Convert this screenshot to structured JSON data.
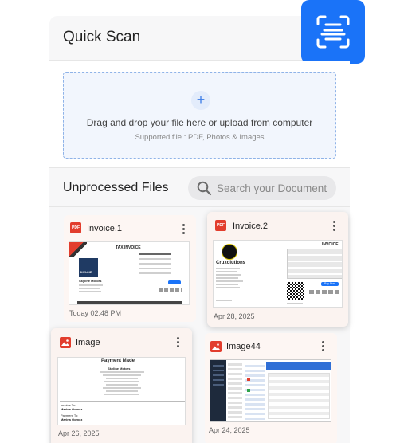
{
  "header": {
    "title": "Quick Scan"
  },
  "scan_button": {
    "icon": "scan-document-icon",
    "color": "#1a73f8"
  },
  "upload": {
    "icon": "plus-icon",
    "instruction": "Drag and drop your file here or upload from computer",
    "supported": "Supported file : PDF, Photos & Images"
  },
  "files": {
    "title": "Unprocessed Files",
    "search_placeholder": "Search your Document"
  },
  "cards": [
    {
      "type": "PDF",
      "name": "Invoice.1",
      "date": "Today 02:48 PM",
      "thumb": {
        "doc_title": "TAX INVOICE",
        "brand": "SKYLINE",
        "company": "Skyline Motors"
      }
    },
    {
      "type": "PDF",
      "name": "Invoice.2",
      "date": "Apr 28, 2025",
      "thumb": {
        "doc_title": "INVOICE",
        "company": "Cruxolutions",
        "pay_button": "Pay Now"
      }
    },
    {
      "type": "Image",
      "name": "Image",
      "date": "Apr 26, 2025",
      "thumb": {
        "doc_title": "Payment Made",
        "company": "Skyline Motors",
        "to_label": "Invoice To:",
        "to_name": "Marina Gomez",
        "paid_label": "Payment To:",
        "paid_name": "Marina Gomez"
      }
    },
    {
      "type": "Image",
      "name": "Image44",
      "date": "Apr 24, 2025",
      "thumb": {}
    }
  ],
  "pdf_badge_label": "PDF",
  "colors": {
    "accent": "#1a73f8",
    "file_badge": "#e23d2d",
    "card_bg": "#fdf6f3"
  }
}
